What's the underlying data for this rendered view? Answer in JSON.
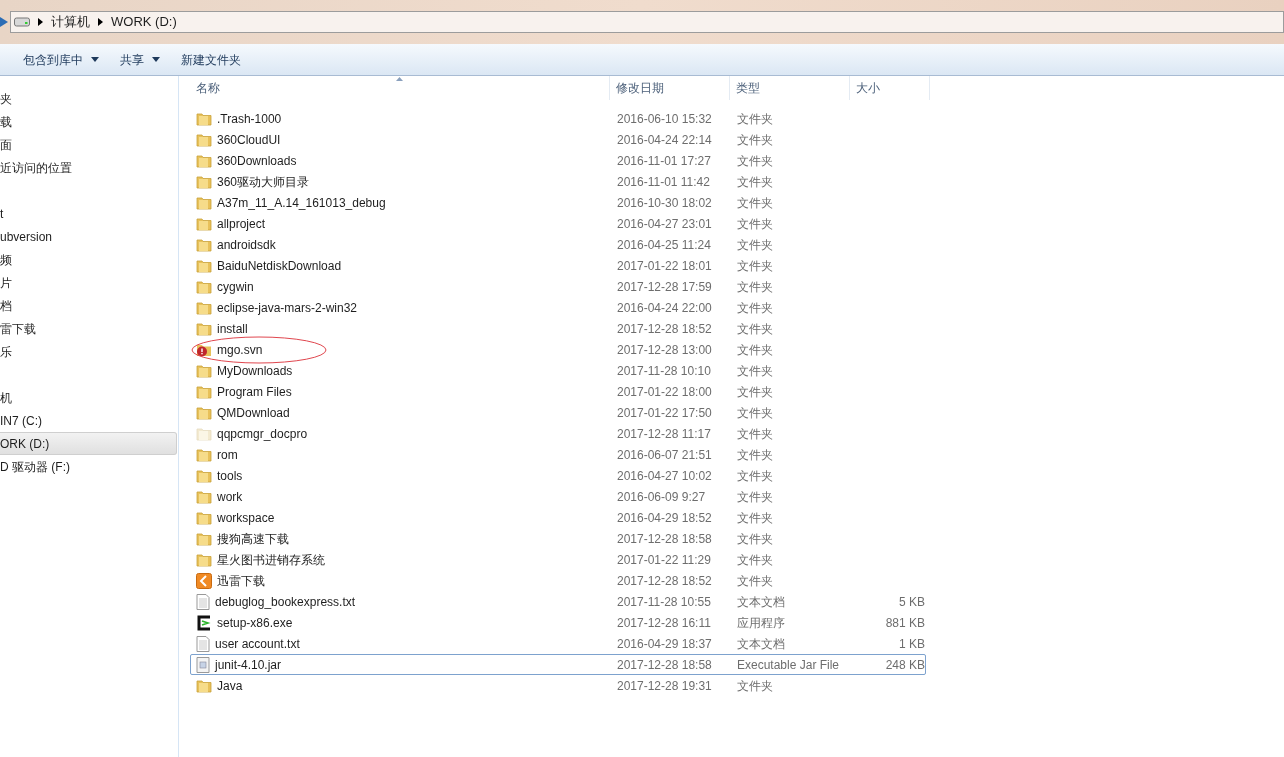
{
  "address_bar": {
    "segments": [
      "计算机",
      "WORK (D:)"
    ]
  },
  "toolbar": {
    "buttons": [
      {
        "label": "包含到库中",
        "dropdown": true
      },
      {
        "label": "共享",
        "dropdown": true
      },
      {
        "label": "新建文件夹",
        "dropdown": false
      }
    ]
  },
  "sidebar": {
    "groups": [
      {
        "items": [
          {
            "label": "夹",
            "selected": false
          },
          {
            "label": "载",
            "selected": false
          },
          {
            "label": "面",
            "selected": false
          },
          {
            "label": "近访问的位置",
            "selected": false
          }
        ]
      },
      {
        "items": [
          {
            "label": "t",
            "selected": false
          },
          {
            "label": "ubversion",
            "selected": false
          },
          {
            "label": "频",
            "selected": false
          },
          {
            "label": "片",
            "selected": false
          },
          {
            "label": "档",
            "selected": false
          },
          {
            "label": "雷下载",
            "selected": false
          },
          {
            "label": "乐",
            "selected": false
          }
        ]
      },
      {
        "items": [
          {
            "label": "机",
            "selected": false
          },
          {
            "label": "IN7 (C:)",
            "selected": false
          },
          {
            "label": "ORK (D:)",
            "selected": true
          },
          {
            "label": "D 驱动器 (F:)",
            "selected": false
          }
        ]
      }
    ]
  },
  "table": {
    "columns": [
      "名称",
      "修改日期",
      "类型",
      "大小"
    ],
    "rows": [
      {
        "kind": "folder",
        "name": ".Trash-1000",
        "date": "2016-06-10 15:32",
        "type": "文件夹",
        "selected": false,
        "circled": false
      },
      {
        "kind": "folder",
        "name": "360CloudUI",
        "date": "2016-04-24 22:14",
        "type": "文件夹",
        "selected": false,
        "circled": false
      },
      {
        "kind": "folder",
        "name": "360Downloads",
        "date": "2016-11-01 17:27",
        "type": "文件夹",
        "selected": false,
        "circled": false
      },
      {
        "kind": "folder",
        "name": "360驱动大师目录",
        "date": "2016-11-01 11:42",
        "type": "文件夹",
        "selected": false,
        "circled": false
      },
      {
        "kind": "folder",
        "name": "A37m_11_A.14_161013_debug",
        "date": "2016-10-30 18:02",
        "type": "文件夹",
        "selected": false,
        "circled": false
      },
      {
        "kind": "folder",
        "name": "allproject",
        "date": "2016-04-27 23:01",
        "type": "文件夹",
        "selected": false,
        "circled": false
      },
      {
        "kind": "folder",
        "name": "androidsdk",
        "date": "2016-04-25 11:24",
        "type": "文件夹",
        "selected": false,
        "circled": false
      },
      {
        "kind": "folder",
        "name": "BaiduNetdiskDownload",
        "date": "2017-01-22 18:01",
        "type": "文件夹",
        "selected": false,
        "circled": false
      },
      {
        "kind": "folder",
        "name": "cygwin",
        "date": "2017-12-28 17:59",
        "type": "文件夹",
        "selected": false,
        "circled": false
      },
      {
        "kind": "folder",
        "name": "eclipse-java-mars-2-win32",
        "date": "2016-04-24 22:00",
        "type": "文件夹",
        "selected": false,
        "circled": false
      },
      {
        "kind": "folder",
        "name": "install",
        "date": "2017-12-28 18:52",
        "type": "文件夹",
        "selected": false,
        "circled": false
      },
      {
        "kind": "svn-error",
        "name": "mgo.svn",
        "date": "2017-12-28 13:00",
        "type": "文件夹",
        "selected": false,
        "circled": true
      },
      {
        "kind": "folder",
        "name": "MyDownloads",
        "date": "2017-11-28 10:10",
        "type": "文件夹",
        "selected": false,
        "circled": false
      },
      {
        "kind": "folder",
        "name": "Program Files",
        "date": "2017-01-22 18:00",
        "type": "文件夹",
        "selected": false,
        "circled": false
      },
      {
        "kind": "folder",
        "name": "QMDownload",
        "date": "2017-01-22 17:50",
        "type": "文件夹",
        "selected": false,
        "circled": false
      },
      {
        "kind": "hidden-folder",
        "name": "qqpcmgr_docpro",
        "date": "2017-12-28 11:17",
        "type": "文件夹",
        "selected": false,
        "circled": false
      },
      {
        "kind": "folder",
        "name": "rom",
        "date": "2016-06-07 21:51",
        "type": "文件夹",
        "selected": false,
        "circled": false
      },
      {
        "kind": "folder",
        "name": "tools",
        "date": "2016-04-27 10:02",
        "type": "文件夹",
        "selected": false,
        "circled": false
      },
      {
        "kind": "folder",
        "name": "work",
        "date": "2016-06-09 9:27",
        "type": "文件夹",
        "selected": false,
        "circled": false
      },
      {
        "kind": "folder",
        "name": "workspace",
        "date": "2016-04-29 18:52",
        "type": "文件夹",
        "selected": false,
        "circled": false
      },
      {
        "kind": "folder",
        "name": "搜狗高速下载",
        "date": "2017-12-28 18:58",
        "type": "文件夹",
        "selected": false,
        "circled": false
      },
      {
        "kind": "folder",
        "name": "星火图书进销存系统",
        "date": "2017-01-22 11:29",
        "type": "文件夹",
        "selected": false,
        "circled": false
      },
      {
        "kind": "app-folder",
        "name": "迅雷下载",
        "date": "2017-12-28 18:52",
        "type": "文件夹",
        "selected": false,
        "circled": false
      },
      {
        "kind": "text",
        "name": "debuglog_bookexpress.txt",
        "date": "2017-11-28 10:55",
        "type": "文本文档",
        "size": "5 KB",
        "selected": false,
        "circled": false
      },
      {
        "kind": "exe",
        "name": "setup-x86.exe",
        "date": "2017-12-28 16:11",
        "type": "应用程序",
        "size": "881 KB",
        "selected": false,
        "circled": false
      },
      {
        "kind": "text",
        "name": "user account.txt",
        "date": "2016-04-29 18:37",
        "type": "文本文档",
        "size": "1 KB",
        "selected": false,
        "circled": false
      },
      {
        "kind": "jar",
        "name": "junit-4.10.jar",
        "date": "2017-12-28 18:58",
        "type": "Executable Jar File",
        "size": "248 KB",
        "selected": true,
        "circled": false
      },
      {
        "kind": "folder",
        "name": "Java",
        "date": "2017-12-28 19:31",
        "type": "文件夹",
        "selected": false,
        "circled": false
      }
    ]
  }
}
